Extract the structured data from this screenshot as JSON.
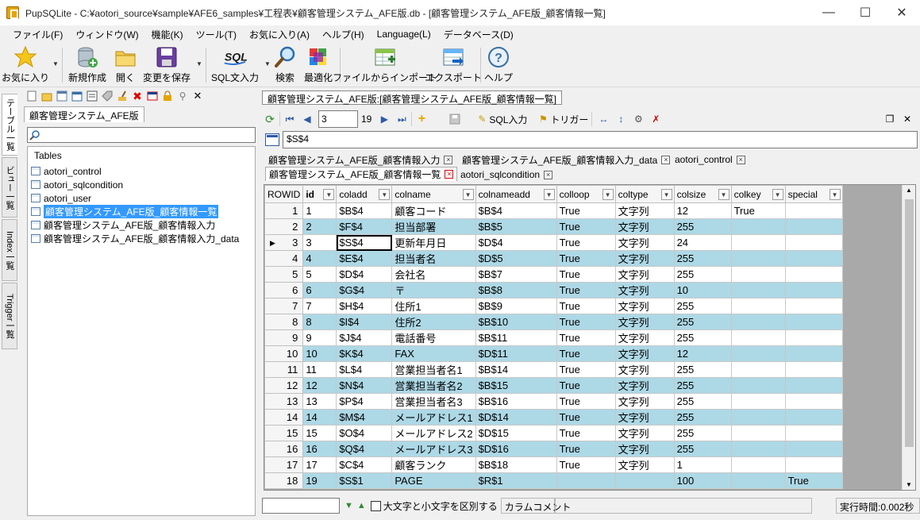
{
  "window": {
    "title": "PupSQLite - C:¥aotori_source¥sample¥AFE6_samples¥工程表¥顧客管理システム_AFE版.db - [顧客管理システム_AFE版_顧客情報一覧]"
  },
  "menu": [
    "ファイル(F)",
    "ウィンドウ(W)",
    "機能(K)",
    "ツール(T)",
    "お気に入り(A)",
    "ヘルプ(H)",
    "Language(L)",
    "データベース(D)"
  ],
  "toolbar": {
    "favorites": "お気に入り",
    "new": "新規作成",
    "open": "開く",
    "save_changes": "変更を保存",
    "sql_input": "SQL文入力",
    "search": "検索",
    "optimize": "最適化",
    "import": "ファイルからインポート",
    "export": "エクスポート",
    "help": "ヘルプ"
  },
  "side_tabs": [
    "テーブル一覧",
    "ビュー一覧",
    "Index一覧",
    "Trigger一覧"
  ],
  "left": {
    "db_tab": "顧客管理システム_AFE版",
    "tree_root": "Tables",
    "tables": [
      "aotori_control",
      "aotori_sqlcondition",
      "aotori_user",
      "顧客管理システム_AFE版_顧客情報一覧",
      "顧客管理システム_AFE版_顧客情報入力",
      "顧客管理システム_AFE版_顧客情報入力_data"
    ],
    "selected_index": 3
  },
  "doc": {
    "tab": "顧客管理システム_AFE版:[顧客管理システム_AFE版_顧客情報一覧]",
    "page_current": "3",
    "page_total": "19",
    "sql_input_btn": "SQL入力",
    "trigger_btn": "トリガー",
    "formula_value": "$S$4"
  },
  "sheet_tabs": [
    {
      "label": "顧客管理システム_AFE版_顧客情報入力",
      "active": false
    },
    {
      "label": "顧客管理システム_AFE版_顧客情報入力_data",
      "active": false
    },
    {
      "label": "aotori_control",
      "active": false
    },
    {
      "label": "顧客管理システム_AFE版_顧客情報一覧",
      "active": true
    },
    {
      "label": "aotori_sqlcondition",
      "active": false
    }
  ],
  "grid": {
    "rowid_header": "ROWID",
    "columns": [
      "id",
      "coladd",
      "colname",
      "colnameadd",
      "colloop",
      "coltype",
      "colsize",
      "colkey",
      "special"
    ],
    "current_row_index": 2,
    "current_col": "coladd",
    "rows": [
      {
        "rowid": "1",
        "cells": [
          "1",
          "$B$4",
          "顧客コード",
          "$B$4",
          "True",
          "文字列",
          "12",
          "True",
          ""
        ]
      },
      {
        "rowid": "2",
        "cells": [
          "2",
          "$F$4",
          "担当部署",
          "$B$5",
          "True",
          "文字列",
          "255",
          "",
          ""
        ]
      },
      {
        "rowid": "3",
        "cells": [
          "3",
          "$S$4",
          "更新年月日",
          "$D$4",
          "True",
          "文字列",
          "24",
          "",
          ""
        ]
      },
      {
        "rowid": "4",
        "cells": [
          "4",
          "$E$4",
          "担当者名",
          "$D$5",
          "True",
          "文字列",
          "255",
          "",
          ""
        ]
      },
      {
        "rowid": "5",
        "cells": [
          "5",
          "$D$4",
          "会社名",
          "$B$7",
          "True",
          "文字列",
          "255",
          "",
          ""
        ]
      },
      {
        "rowid": "6",
        "cells": [
          "6",
          "$G$4",
          "〒",
          "$B$8",
          "True",
          "文字列",
          "10",
          "",
          ""
        ]
      },
      {
        "rowid": "7",
        "cells": [
          "7",
          "$H$4",
          "住所1",
          "$B$9",
          "True",
          "文字列",
          "255",
          "",
          ""
        ]
      },
      {
        "rowid": "8",
        "cells": [
          "8",
          "$I$4",
          "住所2",
          "$B$10",
          "True",
          "文字列",
          "255",
          "",
          ""
        ]
      },
      {
        "rowid": "9",
        "cells": [
          "9",
          "$J$4",
          "電話番号",
          "$B$11",
          "True",
          "文字列",
          "255",
          "",
          ""
        ]
      },
      {
        "rowid": "10",
        "cells": [
          "10",
          "$K$4",
          "FAX",
          "$D$11",
          "True",
          "文字列",
          "12",
          "",
          ""
        ]
      },
      {
        "rowid": "11",
        "cells": [
          "11",
          "$L$4",
          "営業担当者名1",
          "$B$14",
          "True",
          "文字列",
          "255",
          "",
          ""
        ]
      },
      {
        "rowid": "12",
        "cells": [
          "12",
          "$N$4",
          "営業担当者名2",
          "$B$15",
          "True",
          "文字列",
          "255",
          "",
          ""
        ]
      },
      {
        "rowid": "13",
        "cells": [
          "13",
          "$P$4",
          "営業担当者名3",
          "$B$16",
          "True",
          "文字列",
          "255",
          "",
          ""
        ]
      },
      {
        "rowid": "14",
        "cells": [
          "14",
          "$M$4",
          "メールアドレス1",
          "$D$14",
          "True",
          "文字列",
          "255",
          "",
          ""
        ]
      },
      {
        "rowid": "15",
        "cells": [
          "15",
          "$O$4",
          "メールアドレス2",
          "$D$15",
          "True",
          "文字列",
          "255",
          "",
          ""
        ]
      },
      {
        "rowid": "16",
        "cells": [
          "16",
          "$Q$4",
          "メールアドレス3",
          "$D$16",
          "True",
          "文字列",
          "255",
          "",
          ""
        ]
      },
      {
        "rowid": "17",
        "cells": [
          "17",
          "$C$4",
          "顧客ランク",
          "$B$18",
          "True",
          "文字列",
          "1",
          "",
          ""
        ]
      },
      {
        "rowid": "18",
        "cells": [
          "19",
          "$S$1",
          "PAGE",
          "$R$1",
          "",
          "",
          "100",
          "",
          "True"
        ]
      }
    ]
  },
  "status": {
    "case_sensitive": "大文字と小文字を区別する",
    "column_comment": "カラムコメント",
    "exec_time": "実行時間:0.002秒"
  },
  "colors": {
    "row_highlight": "#add8e6",
    "selection": "#3399ff"
  }
}
